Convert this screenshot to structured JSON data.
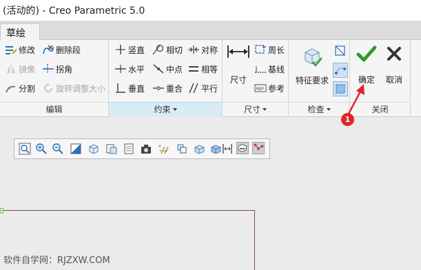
{
  "window": {
    "title": "(活动的) - Creo Parametric 5.0"
  },
  "tabs": [
    {
      "label": "草绘"
    }
  ],
  "ribbon": {
    "edit_group": {
      "label": "编辑",
      "items": [
        {
          "label": "修改",
          "icon": "modify-icon",
          "enabled": true
        },
        {
          "label": "删除段",
          "icon": "delete-segment-icon",
          "enabled": true
        },
        {
          "label": "镜像",
          "icon": "mirror-icon",
          "enabled": false
        },
        {
          "label": "拐角",
          "icon": "corner-icon",
          "enabled": true
        },
        {
          "label": "分割",
          "icon": "divide-icon",
          "enabled": true
        },
        {
          "label": "旋转调整大小",
          "icon": "rotate-resize-icon",
          "enabled": false
        }
      ]
    },
    "constrain_group": {
      "label": "约束",
      "items": [
        {
          "label": "竖直",
          "icon": "vertical-icon"
        },
        {
          "label": "相切",
          "icon": "tangent-icon"
        },
        {
          "label": "对称",
          "icon": "symmetric-icon"
        },
        {
          "label": "水平",
          "icon": "horizontal-icon"
        },
        {
          "label": "中点",
          "icon": "midpoint-icon"
        },
        {
          "label": "相等",
          "icon": "equal-icon"
        },
        {
          "label": "垂直",
          "icon": "perpendicular-icon"
        },
        {
          "label": "重合",
          "icon": "coincident-icon"
        },
        {
          "label": "平行",
          "icon": "parallel-icon"
        }
      ]
    },
    "dimension_group": {
      "label": "尺寸",
      "big": {
        "label": "尺寸",
        "icon": "dimension-icon"
      },
      "items": [
        {
          "label": "周长",
          "icon": "perimeter-icon"
        },
        {
          "label": "基线",
          "icon": "baseline-icon"
        },
        {
          "label": "参考",
          "icon": "reference-icon"
        }
      ]
    },
    "inspect_group": {
      "label": "检查",
      "big": {
        "label": "特征要求",
        "icon": "feature-requirements-icon"
      },
      "small_icons": [
        "overlapping-geometry-icon",
        "highlight-open-ends-icon",
        "shade-closed-loops-icon"
      ]
    },
    "close_group": {
      "label": "关闭",
      "ok": {
        "label": "确定",
        "icon": "checkmark-icon",
        "color": "#2e9b2e"
      },
      "cancel": {
        "label": "取消",
        "icon": "close-x-icon",
        "color": "#333333"
      }
    }
  },
  "graphics_toolbar": {
    "icons": [
      "refit-icon",
      "zoom-in-icon",
      "zoom-out-icon",
      "repaint-icon",
      "display-style-icon",
      "saved-orientations-icon",
      "view-manager-icon",
      "perspective-view-icon",
      "datum-display-icon",
      "spin-center-icon",
      "annotation-display-icon",
      "shaded-model-icon",
      "sketch-view-icon",
      "display-constraints-icon",
      "display-vertices-icon"
    ]
  },
  "watermark": {
    "text": "软件自学网：RJZXW.COM"
  },
  "callout": {
    "number": "1",
    "color": "#e0262a"
  }
}
